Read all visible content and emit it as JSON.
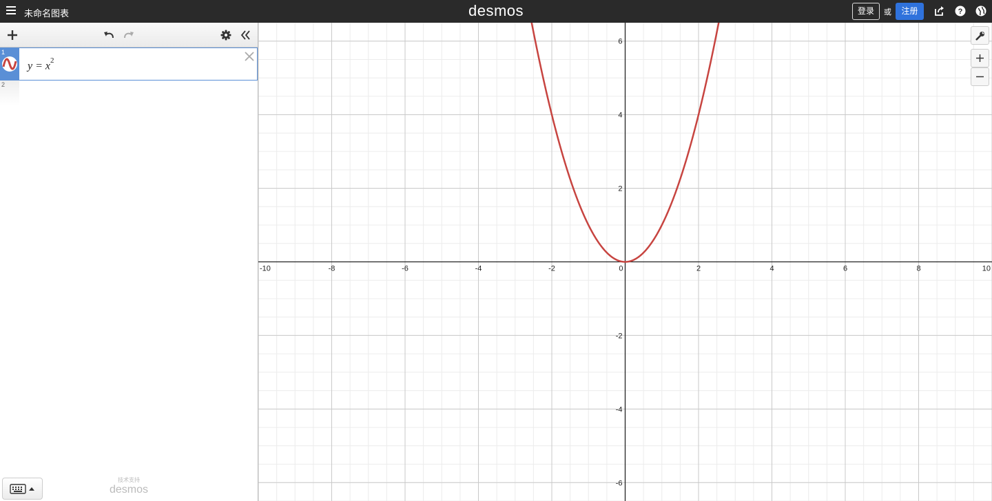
{
  "header": {
    "title": "未命名图表",
    "brand": "desmos",
    "login_label": "登录",
    "or_label": "或",
    "signup_label": "注册",
    "background_color": "#2a2a2a",
    "signup_color": "#2f72dc"
  },
  "toolbar": {
    "icons": [
      "add-icon",
      "undo-icon",
      "redo-icon",
      "settings-gear-icon",
      "collapse-panel-icon"
    ]
  },
  "expressions": [
    {
      "index": "1",
      "base": "y = x",
      "exponent": "2",
      "color": "#c74440",
      "active_color": "#5a8fd6"
    },
    {
      "index": "2",
      "base": "",
      "exponent": ""
    }
  ],
  "footer": {
    "powered_by_label": "技术支持",
    "powered_by_brand": "desmos"
  },
  "graph": {
    "x_range": [
      -10,
      10
    ],
    "y_range": [
      -6.5,
      6.5
    ],
    "x_ticks": [
      "-10",
      "-8",
      "-6",
      "-4",
      "-2",
      "0",
      "2",
      "4",
      "6",
      "8",
      "10"
    ],
    "y_ticks": [
      "6",
      "4",
      "2",
      "-2",
      "-4",
      "-6"
    ],
    "major_step": 2,
    "minor_step": 0.5,
    "curve": "y = x^2",
    "curve_color": "#c74440",
    "grid": true
  }
}
